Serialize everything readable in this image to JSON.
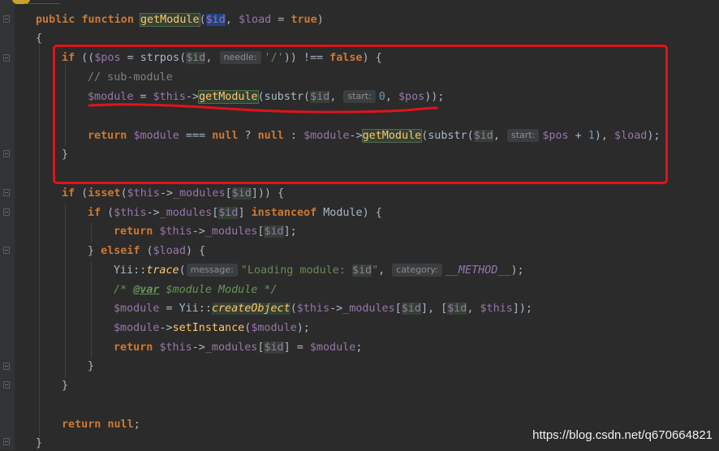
{
  "editor": {
    "lines": {
      "l1": [
        "public",
        "function",
        "getModule",
        "(",
        "$id",
        ", ",
        "$load",
        " = ",
        "true",
        ")"
      ],
      "l2": [
        "{"
      ],
      "l3": [
        "if",
        " ((",
        "$pos",
        " = strpos(",
        "$id",
        ", ",
        "needle:",
        "'/'",
        ")) !== ",
        "false",
        ") {"
      ],
      "l4": [
        "// sub-module"
      ],
      "l5": [
        "$module",
        " = ",
        "$this",
        "->",
        "getModule",
        "(substr(",
        "$id",
        ", ",
        "start:",
        "0",
        ", ",
        "$pos",
        "));"
      ],
      "l6": [
        "return",
        " ",
        "$module",
        " === ",
        "null",
        " ? ",
        "null",
        " : ",
        "$module",
        "->",
        "getModule",
        "(substr(",
        "$id",
        ", ",
        "start:",
        "$pos",
        " + ",
        "1",
        "), ",
        "$load",
        ");"
      ],
      "l7": [
        "}"
      ],
      "l8": [
        "if",
        " (",
        "isset",
        "(",
        "$this",
        "->",
        "_modules",
        "[",
        "$id",
        "])) {"
      ],
      "l9": [
        "if",
        " (",
        "$this",
        "->",
        "_modules",
        "[",
        "$id",
        "] ",
        "instanceof",
        " Module) {"
      ],
      "l10": [
        "return",
        " ",
        "$this",
        "->",
        "_modules",
        "[",
        "$id",
        "];"
      ],
      "l11": [
        "} ",
        "elseif",
        " (",
        "$load",
        ") {"
      ],
      "l12": [
        "Yii::",
        "trace",
        "(",
        "message:",
        "\"Loading module: ",
        "$id",
        "\"",
        ", ",
        "category:",
        "__METHOD__",
        ");"
      ],
      "l13": [
        "/* ",
        "@var",
        " ",
        "$module",
        " Module */"
      ],
      "l14": [
        "$module",
        " = Yii::",
        "createObject",
        "(",
        "$this",
        "->",
        "_modules",
        "[",
        "$id",
        "], [",
        "$id",
        ", ",
        "$this",
        "]);"
      ],
      "l15": [
        "$module",
        "->",
        "setInstance",
        "(",
        "$module",
        ");"
      ],
      "l16": [
        "return",
        " ",
        "$this",
        "->",
        "_modules",
        "[",
        "$id",
        "] = ",
        "$module",
        ";"
      ],
      "l17": [
        "}"
      ],
      "l18": [
        "}"
      ],
      "l19": [
        "return",
        " ",
        "null",
        ";"
      ],
      "l20": [
        "}"
      ]
    },
    "colors": {
      "background": "#2b2b2b",
      "keyword": "#cc7832",
      "variable": "#9876aa",
      "string": "#6a8759",
      "number": "#6897bb",
      "annotation_box": "#e0141a"
    }
  },
  "watermark": "https://blog.csdn.net/q670664821"
}
